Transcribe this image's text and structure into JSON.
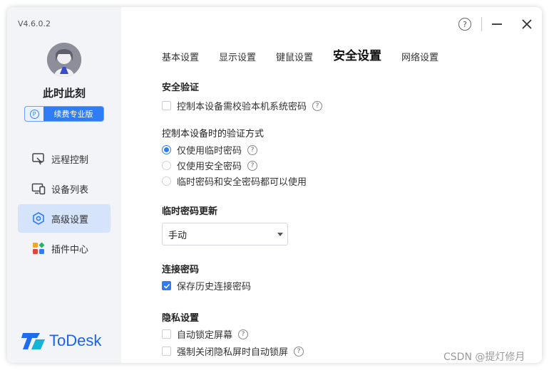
{
  "app": {
    "version": "V4.6.0.2",
    "username": "此时此刻",
    "badge_icon": "P",
    "badge_label": "续费专业版",
    "logo_text": "ToDesk",
    "accent_color": "#2e7cf6"
  },
  "sidebar": {
    "items": [
      {
        "label": "远程控制",
        "icon": "remote-control-icon",
        "active": false
      },
      {
        "label": "设备列表",
        "icon": "device-list-icon",
        "active": false
      },
      {
        "label": "高级设置",
        "icon": "advanced-settings-icon",
        "active": true
      },
      {
        "label": "插件中心",
        "icon": "plugin-center-icon",
        "active": false
      }
    ]
  },
  "window_controls": {
    "help": "?"
  },
  "tabs": [
    {
      "label": "基本设置",
      "active": false
    },
    {
      "label": "显示设置",
      "active": false
    },
    {
      "label": "键鼠设置",
      "active": false
    },
    {
      "label": "安全设置",
      "active": true
    },
    {
      "label": "网络设置",
      "active": false
    }
  ],
  "security": {
    "verify_title": "安全验证",
    "verify_option": {
      "label": "控制本设备需校验本机系统密码",
      "checked": false
    },
    "method_title": "控制本设备时的验证方式",
    "methods": [
      {
        "label": "仅使用临时密码",
        "checked": true,
        "help": true
      },
      {
        "label": "仅使用安全密码",
        "checked": false,
        "help": true
      },
      {
        "label": "临时密码和安全密码都可以使用",
        "checked": false,
        "help": false
      }
    ],
    "temp_title": "临时密码更新",
    "temp_select": "手动",
    "conn_title": "连接密码",
    "conn_option": {
      "label": "保存历史连接密码",
      "checked": true
    },
    "privacy_title": "隐私设置",
    "privacy_options": [
      {
        "label": "自动锁定屏幕",
        "checked": false
      },
      {
        "label": "强制关闭隐私屏时自动锁屏",
        "checked": false
      }
    ]
  },
  "watermark": "CSDN @提灯修月"
}
